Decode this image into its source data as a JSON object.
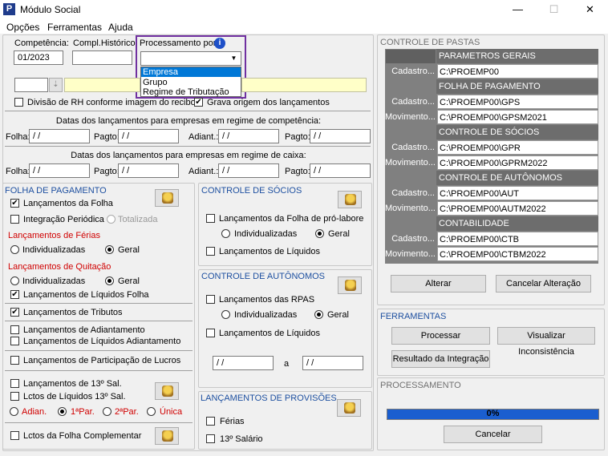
{
  "window": {
    "title": "Módulo Social",
    "min": "—",
    "max": "☐",
    "close": "✕"
  },
  "menu": [
    "Opções",
    "Ferramentas",
    "Ajuda"
  ],
  "top": {
    "competencia_label": "Competência:",
    "competencia_value": "01/2023",
    "compl_label": "Compl.Histórico:",
    "compl_value": "",
    "proc_label": "Processamento por:",
    "proc_value": "",
    "proc_options": [
      "Empresa",
      "Grupo",
      "Regime de Tributação"
    ]
  },
  "checks": {
    "divisao": "Divisão de RH conforme imagem do recibo",
    "grava": "Grava origem dos lançamentos"
  },
  "dates": {
    "comp_title": "Datas dos lançamentos para empresas em regime de competência:",
    "caixa_title": "Datas dos lançamentos para empresas em regime de caixa:",
    "folha": "Folha:",
    "pagto": "Pagto:",
    "adiant": "Adiant.:",
    "placeholder": " / /"
  },
  "folha": {
    "title": "FOLHA DE PAGAMENTO",
    "lanc_folha": "Lançamentos da Folha",
    "integ": "Integração Periódica",
    "totalizada": "Totalizada",
    "ferias": "Lançamentos de Férias",
    "individualizadas": "Individualizadas",
    "geral": "Geral",
    "quitacao": "Lançamentos de Quitação",
    "liquidos_folha": "Lançamentos de Líquidos Folha",
    "tributos": "Lançamentos de Tributos",
    "adiantamento": "Lançamentos de Adiantamento",
    "liquidos_adiant": "Lançamentos de Líquidos Adiantamento",
    "lucros": "Lançamentos de Participação de Lucros",
    "decimo": "Lançamentos de 13º Sal.",
    "liq_decimo": "Lctos de Líquidos 13º Sal.",
    "adian": "Adian.",
    "primeira": "1ªPar.",
    "segunda": "2ªPar.",
    "unica": "Única",
    "complementar": "Lctos da Folha Complementar"
  },
  "socios": {
    "title": "CONTROLE DE SÓCIOS",
    "pro_labore": "Lançamentos da Folha de pró-labore",
    "individualizadas": "Individualizadas",
    "geral": "Geral",
    "liquidos": "Lançamentos de Líquidos"
  },
  "autonomos": {
    "title": "CONTROLE DE AUTÔNOMOS",
    "rpas": "Lançamentos das RPAS",
    "individualizadas": "Individualizadas",
    "geral": "Geral",
    "liquidos": "Lançamentos de Líquidos",
    "de": " / /",
    "a": "a",
    "ate": " / /"
  },
  "provisoes": {
    "title": "LANÇAMENTOS DE PROVISÕES",
    "ferias": "Férias",
    "decimo": "13º Salário"
  },
  "pastas": {
    "title": "CONTROLE DE PASTAS",
    "groups": [
      {
        "header": "PARAMETROS GERAIS",
        "rows": [
          [
            "Cadastro...",
            "C:\\PROEMP00"
          ]
        ]
      },
      {
        "header": "FOLHA DE PAGAMENTO",
        "rows": [
          [
            "Cadastro...",
            "C:\\PROEMP00\\GPS"
          ],
          [
            "Movimento...",
            "C:\\PROEMP00\\GPSM2021"
          ]
        ]
      },
      {
        "header": "CONTROLE DE SÓCIOS",
        "rows": [
          [
            "Cadastro...",
            "C:\\PROEMP00\\GPR"
          ],
          [
            "Movimento...",
            "C:\\PROEMP00\\GPRM2022"
          ]
        ]
      },
      {
        "header": "CONTROLE DE AUTÔNOMOS",
        "rows": [
          [
            "Cadastro...",
            "C:\\PROEMP00\\AUT"
          ],
          [
            "Movimento...",
            "C:\\PROEMP00\\AUTM2022"
          ]
        ]
      },
      {
        "header": "CONTABILIDADE",
        "rows": [
          [
            "Cadastro...",
            "C:\\PROEMP00\\CTB"
          ],
          [
            "Movimento...",
            "C:\\PROEMP00\\CTBM2022"
          ]
        ]
      }
    ],
    "alterar": "Alterar",
    "cancelar_alt": "Cancelar Alteração"
  },
  "ferramentas": {
    "title": "FERRAMENTAS",
    "processar": "Processar",
    "visualizar": "Visualizar Inconsistência",
    "resultado": "Resultado da Integração"
  },
  "processamento": {
    "title": "PROCESSAMENTO",
    "progress_text": "0%",
    "progress": 0,
    "cancelar": "Cancelar"
  },
  "colors": {
    "accent": "#1e50a0",
    "highlight": "#7030a0",
    "progress": "#1a5ecf"
  }
}
